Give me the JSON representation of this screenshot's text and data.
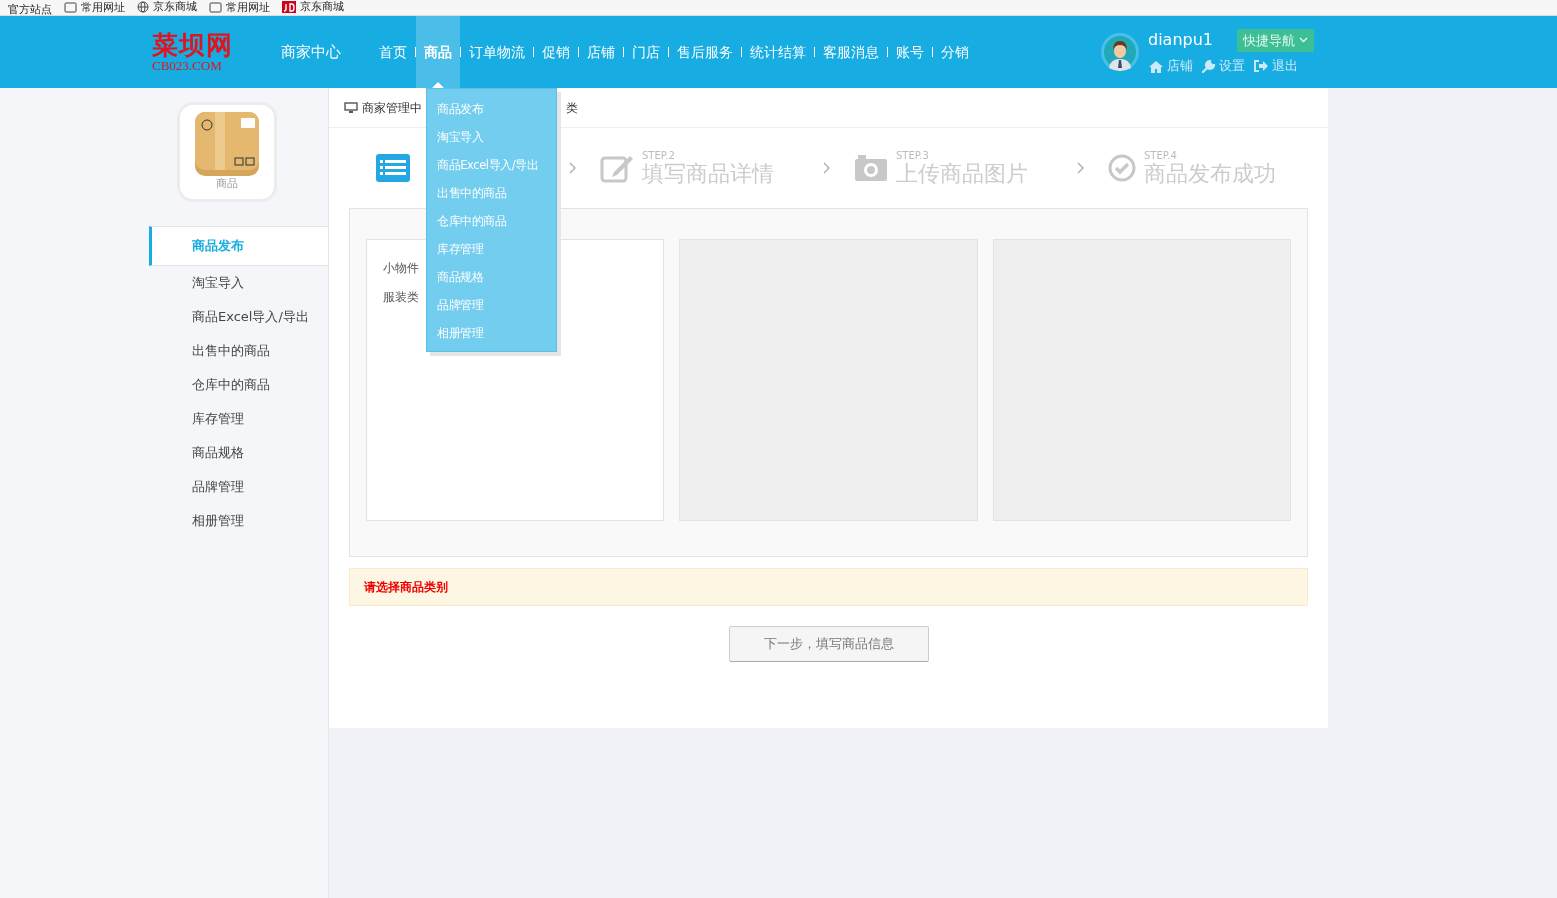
{
  "bookmarks": [
    {
      "label": "官方站点"
    },
    {
      "label": "常用网址"
    },
    {
      "label": "京东商城"
    },
    {
      "label": "常用网址"
    },
    {
      "label": "京东商城"
    }
  ],
  "logo": {
    "name": "菜坝网",
    "domain": "CB023.COM"
  },
  "header": {
    "title": "商家中心"
  },
  "nav": [
    {
      "label": "首页",
      "selected": false
    },
    {
      "label": "商品",
      "selected": true
    },
    {
      "label": "订单物流",
      "selected": false
    },
    {
      "label": "促销",
      "selected": false
    },
    {
      "label": "店铺",
      "selected": false
    },
    {
      "label": "门店",
      "selected": false
    },
    {
      "label": "售后服务",
      "selected": false
    },
    {
      "label": "统计结算",
      "selected": false
    },
    {
      "label": "客服消息",
      "selected": false
    },
    {
      "label": "账号",
      "selected": false
    },
    {
      "label": "分销",
      "selected": false
    }
  ],
  "user": {
    "name": "dianpu1",
    "quick_nav": "快捷导航",
    "links": [
      {
        "label": "店铺"
      },
      {
        "label": "设置"
      },
      {
        "label": "退出"
      }
    ]
  },
  "dropdown": [
    "商品发布",
    "淘宝导入",
    "商品Excel导入/导出",
    "出售中的商品",
    "仓库中的商品",
    "库存管理",
    "商品规格",
    "品牌管理",
    "相册管理"
  ],
  "sidebar": {
    "caption": "商品",
    "items": [
      {
        "label": "商品发布",
        "selected": true
      },
      {
        "label": "淘宝导入",
        "selected": false
      },
      {
        "label": "商品Excel导入/导出",
        "selected": false
      },
      {
        "label": "出售中的商品",
        "selected": false
      },
      {
        "label": "仓库中的商品",
        "selected": false
      },
      {
        "label": "库存管理",
        "selected": false
      },
      {
        "label": "商品规格",
        "selected": false
      },
      {
        "label": "品牌管理",
        "selected": false
      },
      {
        "label": "相册管理",
        "selected": false
      }
    ]
  },
  "breadcrumb": [
    "商家管理中",
    "类"
  ],
  "steps": [
    {
      "selected": true
    },
    {
      "step": "STEP.2",
      "title": "填写商品详情",
      "selected": false
    },
    {
      "step": "STEP.3",
      "title": "上传商品图片",
      "selected": false
    },
    {
      "step": "STEP.4",
      "title": "商品发布成功",
      "selected": false
    }
  ],
  "categories": [
    "小物件",
    "服装类"
  ],
  "warning": "请选择商品类别",
  "next_button": {
    "label": "下一步，填写商品信息",
    "disabled": true
  }
}
